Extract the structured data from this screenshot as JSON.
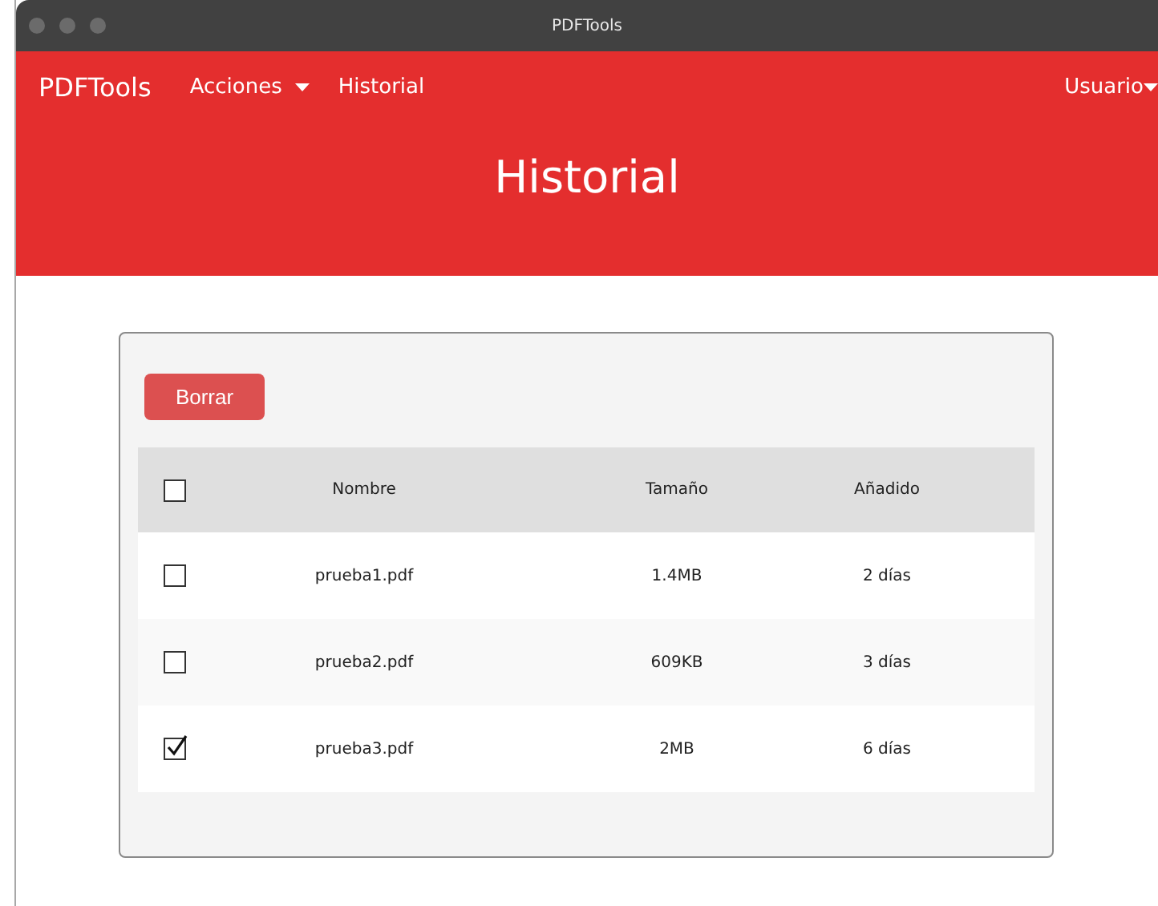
{
  "window": {
    "title": "PDFTools"
  },
  "navbar": {
    "brand": "PDFTools",
    "items": [
      {
        "label": "Acciones",
        "dropdown": true
      },
      {
        "label": "Historial",
        "dropdown": false
      }
    ],
    "user": {
      "label": "Usuario",
      "dropdown": true
    }
  },
  "page_title": "Historial",
  "delete_button": "Borrar",
  "table": {
    "select_all": {
      "checked": false
    },
    "columns": [
      "Nombre",
      "Tamaño",
      "Añadido"
    ],
    "rows": [
      {
        "checked": false,
        "cells": [
          "prueba1.pdf",
          "1.4MB",
          "2 días"
        ]
      },
      {
        "checked": false,
        "cells": [
          "prueba2.pdf",
          "609KB",
          "3 días"
        ]
      },
      {
        "checked": true,
        "cells": [
          "prueba3.pdf",
          "2MB",
          "6 días"
        ]
      }
    ]
  }
}
